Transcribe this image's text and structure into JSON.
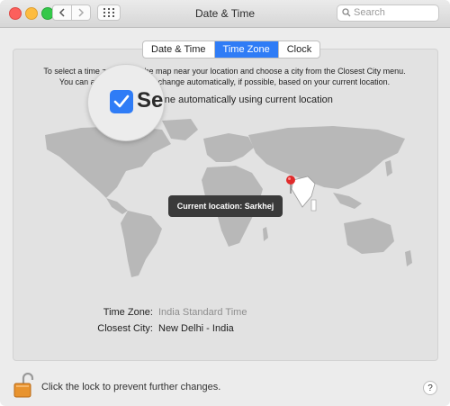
{
  "window": {
    "title": "Date & Time"
  },
  "search": {
    "placeholder": "Search"
  },
  "tabs": [
    {
      "label": "Date & Time",
      "active": false
    },
    {
      "label": "Time Zone",
      "active": true
    },
    {
      "label": "Clock",
      "active": false
    }
  ],
  "description": {
    "line1": "To select a time zone, click the map near your location and choose a city from the Closest City menu.",
    "line2": "You can also set time zone change automatically, if possible, based on your current location."
  },
  "auto_timezone": {
    "label": "Set time zone automatically using current location",
    "label_visible": "e zone automatically using current location",
    "magnified_text": "Se",
    "checked": true
  },
  "map": {
    "tooltip": "Current location: Sarkhej"
  },
  "timezone": {
    "label": "Time Zone:",
    "value": "India Standard Time"
  },
  "closest_city": {
    "label": "Closest City:",
    "value": "New Delhi - India"
  },
  "footer": {
    "lock_text": "Click the lock to prevent further changes.",
    "help": "?"
  },
  "colors": {
    "accent": "#2f7cf6",
    "map_land": "#b8b8b8",
    "map_highlight": "#ffffff",
    "pin": "#e02b2b"
  }
}
